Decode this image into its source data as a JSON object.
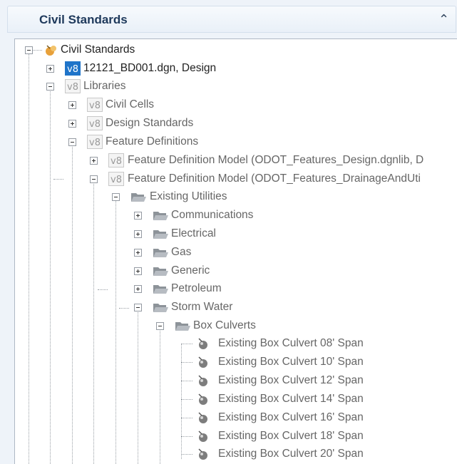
{
  "panel": {
    "title": "Civil Standards",
    "collapse_glyph": "⌃"
  },
  "tree": {
    "root": "Civil Standards",
    "design_file": "12121_BD001.dgn, Design",
    "libraries": "Libraries",
    "civil_cells": "Civil Cells",
    "design_standards": "Design Standards",
    "feature_definitions": "Feature Definitions",
    "fdm_design": "Feature Definition Model (ODOT_Features_Design.dgnlib, D",
    "fdm_drainage": "Feature Definition Model (ODOT_Features_DrainageAndUti",
    "existing_utilities": "Existing Utilities",
    "utilities": [
      "Communications",
      "Electrical",
      "Gas",
      "Generic",
      "Petroleum",
      "Storm Water"
    ],
    "box_culverts": "Box Culverts",
    "culverts": [
      "Existing Box Culvert 08' Span",
      "Existing Box Culvert 10' Span",
      "Existing Box Culvert 12' Span",
      "Existing Box Culvert 14' Span",
      "Existing Box Culvert 16' Span",
      "Existing Box Culvert 18' Span",
      "Existing Box Culvert 20' Span"
    ]
  },
  "icons": {
    "root": "civil-standards-icon",
    "model": "v8-model-icon",
    "folder": "folder-open-icon",
    "feature": "feature-definition-icon"
  }
}
